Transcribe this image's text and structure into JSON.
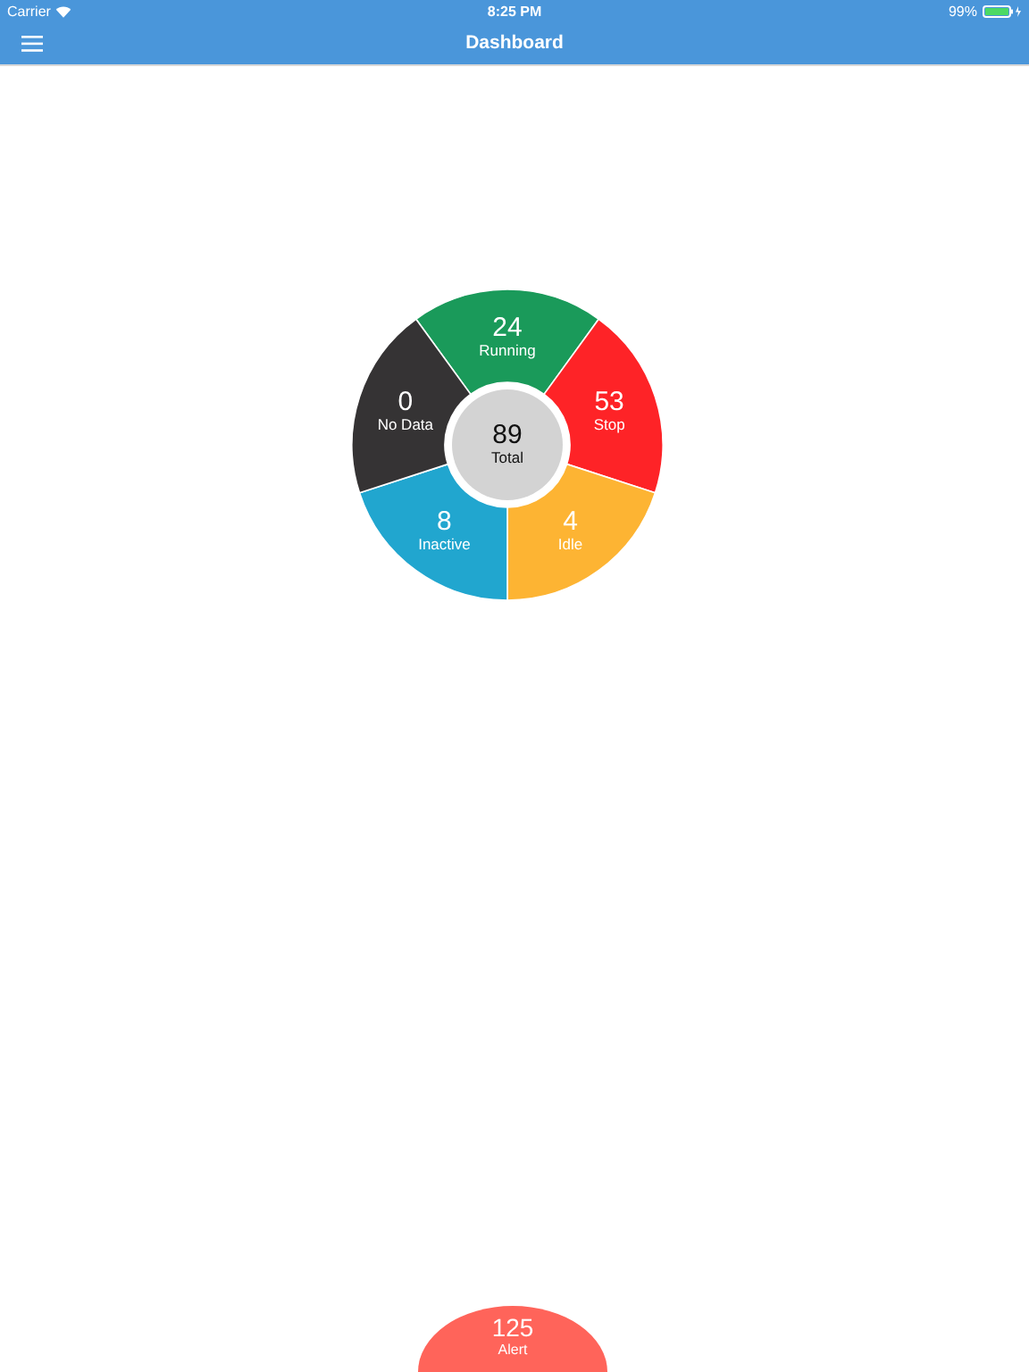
{
  "status_bar": {
    "carrier": "Carrier",
    "time": "8:25 PM",
    "battery": "99%"
  },
  "nav_bar": {
    "title": "Dashboard"
  },
  "wheel": {
    "segments": [
      {
        "value": "24",
        "label": "Running",
        "color": "#1a9a5a"
      },
      {
        "value": "53",
        "label": "Stop",
        "color": "#fe2327"
      },
      {
        "value": "4",
        "label": "Idle",
        "color": "#fdb433"
      },
      {
        "value": "8",
        "label": "Inactive",
        "color": "#21a6cf"
      },
      {
        "value": "0",
        "label": "No Data",
        "color": "#353334"
      }
    ],
    "center": {
      "value": "89",
      "label": "Total"
    }
  },
  "alert": {
    "value": "125",
    "label": "Alert"
  }
}
